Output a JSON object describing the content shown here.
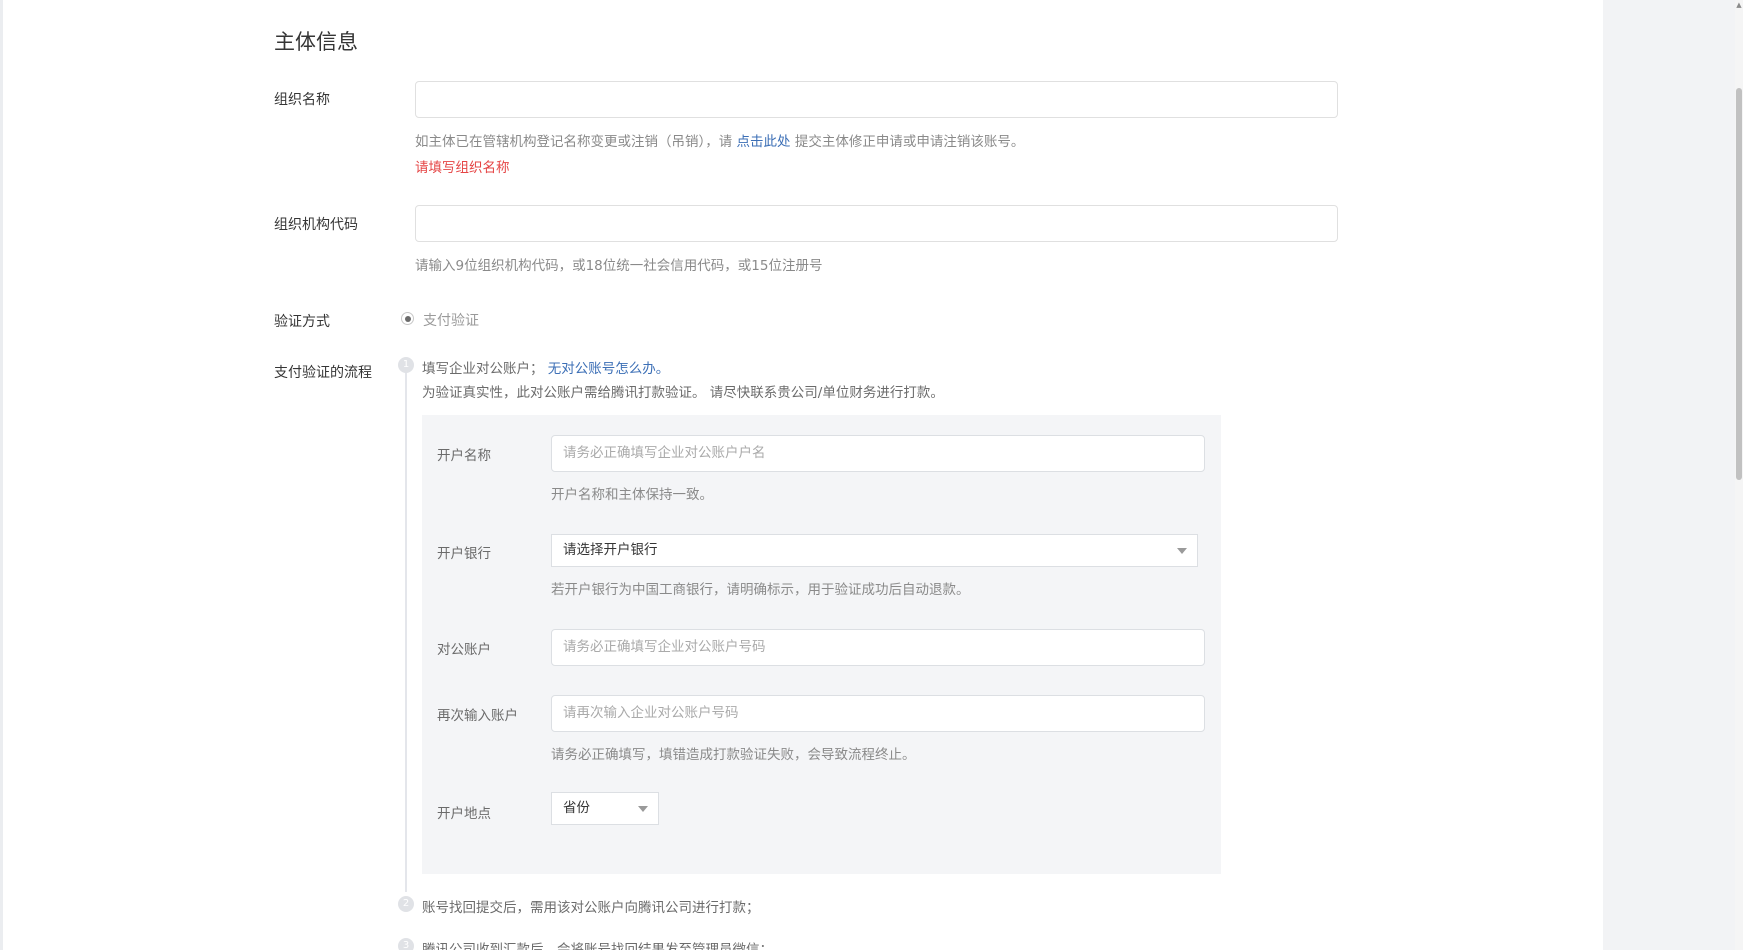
{
  "section": {
    "title": "主体信息"
  },
  "org_name": {
    "label": "组织名称",
    "value": "",
    "hint_prefix": "如主体已在管辖机构登记名称变更或注销（吊销），请 ",
    "hint_link": "点击此处",
    "hint_suffix": " 提交主体修正申请或申请注销该账号。",
    "error": "请填写组织名称"
  },
  "org_code": {
    "label": "组织机构代码",
    "value": "",
    "hint": "请输入9位组织机构代码，或18位统一社会信用代码，或15位注册号"
  },
  "verify_method": {
    "label": "验证方式",
    "option": "支付验证"
  },
  "pay_flow": {
    "label": "支付验证的流程",
    "steps": [
      {
        "num": "1",
        "text": "填写企业对公账户；",
        "link": "无对公账号怎么办。",
        "desc": "为验证真实性，此对公账户需给腾讯打款验证。 请尽快联系贵公司/单位财务进行打款。"
      },
      {
        "num": "2",
        "text": "账号找回提交后，需用该对公账户向腾讯公司进行打款；"
      },
      {
        "num": "3",
        "text": "腾讯公司收到汇款后，会将账号找回结果发至管理员微信；"
      }
    ]
  },
  "bank_form": {
    "account_name": {
      "label": "开户名称",
      "placeholder": "请务必正确填写企业对公账户户名",
      "hint": "开户名称和主体保持一致。"
    },
    "bank": {
      "label": "开户银行",
      "selected": "请选择开户银行",
      "hint": "若开户银行为中国工商银行，请明确标示，用于验证成功后自动退款。"
    },
    "account": {
      "label": "对公账户",
      "placeholder": "请务必正确填写企业对公账户号码"
    },
    "account_confirm": {
      "label": "再次输入账户",
      "placeholder": "请再次输入企业对公账户号码",
      "hint": "请务必正确填写，填错造成打款验证失败，会导致流程终止。"
    },
    "location": {
      "label": "开户地点",
      "selected": "省份"
    }
  }
}
